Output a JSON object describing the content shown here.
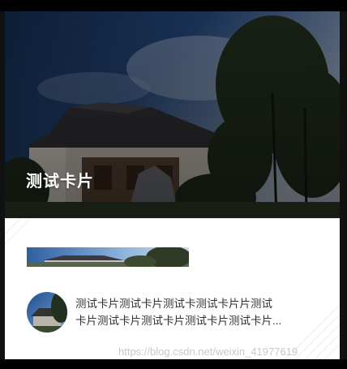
{
  "card": {
    "title": "测试卡片",
    "description_line1": "测试卡片测试卡片测试卡测试卡片片测试",
    "description_line2": "卡片测试卡片测试卡片测试卡片测试卡片..."
  },
  "watermark": "https://blog.csdn.net/weixin_41977619",
  "colors": {
    "card_bg": "#ffffff",
    "title_text": "#ffffff",
    "desc_text": "#333333",
    "frame": "#000000"
  }
}
